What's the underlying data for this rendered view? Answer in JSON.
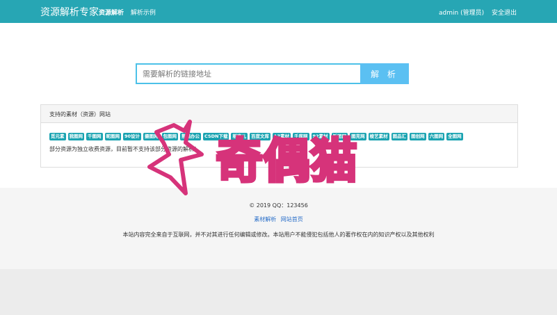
{
  "nav": {
    "brand": "资源解析专家",
    "links": [
      "资源解析",
      "解析示例"
    ],
    "user": "admin (管理员)",
    "logout": "安全退出"
  },
  "search": {
    "placeholder": "需要解析的链接地址",
    "button": "解 析"
  },
  "panel": {
    "title": "支持的素材（资源）网站",
    "tags": [
      "觅元素",
      "我图网",
      "千图网",
      "昵图网",
      "90设计",
      "摄图网",
      "包图网",
      "熊猫办公",
      "CSDN下载",
      "稻壳儿",
      "百度文库",
      "17素材",
      "千库网",
      "92素材",
      "饭团网",
      "图克网",
      "梭艺素材",
      "图品汇",
      "图创网",
      "六图网",
      "全图网"
    ],
    "notice": "部分资源为独立收费资源，目前暂不支持该部分资源的解析！"
  },
  "footer": {
    "copyright": "© 2019 QQ：123456",
    "links": [
      "素材解析",
      "网站首页"
    ],
    "disclaimer": "本站内容完全来自于互联网，并不对其进行任何编辑或修改。本站用户不能侵犯包括他人的著作权在内的知识产权以及其他权利"
  },
  "watermark": {
    "text": "奇偶猫",
    "color": "#d6337a"
  }
}
